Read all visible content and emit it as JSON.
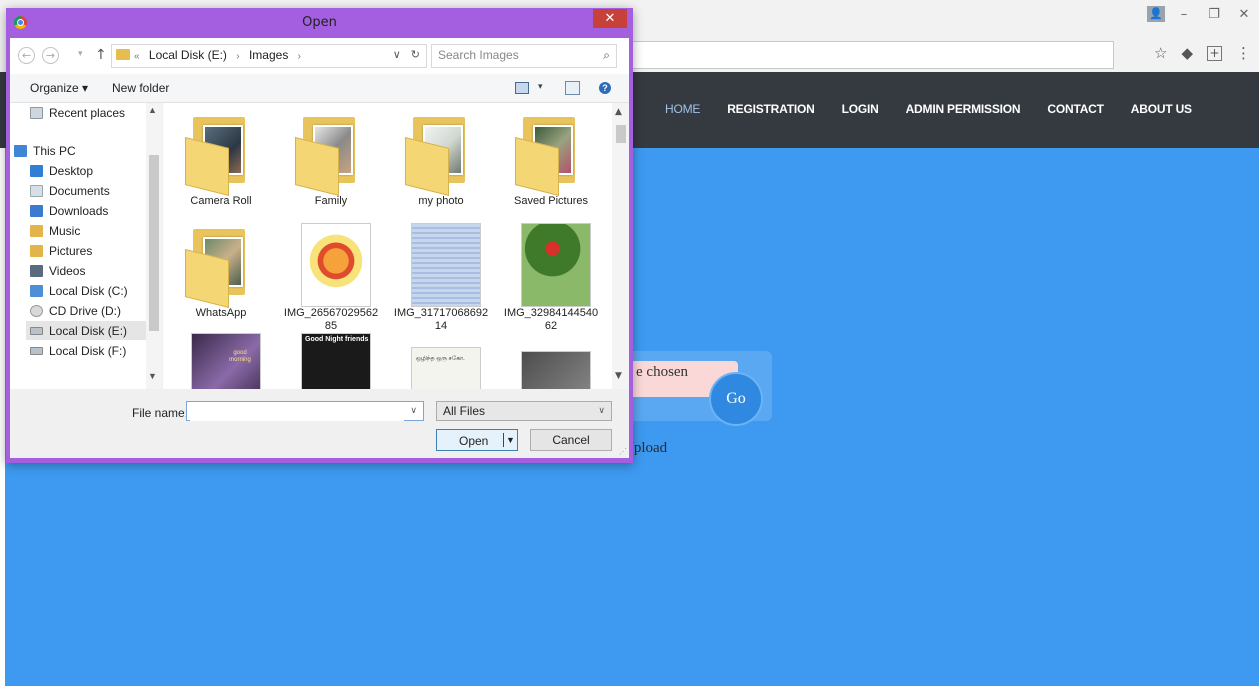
{
  "browser": {
    "window_controls": {
      "user": "👤",
      "minimize": "–",
      "restore": "❐",
      "close": "✕"
    },
    "address_icons": {
      "star": "☆",
      "extension": "◆",
      "plus": "+",
      "menu": "⋮"
    }
  },
  "site": {
    "nav": [
      {
        "label": "HOME"
      },
      {
        "label": "REGISTRATION"
      },
      {
        "label": "LOGIN"
      },
      {
        "label": "ADMIN PERMISSION"
      },
      {
        "label": "CONTACT"
      },
      {
        "label": "ABOUT US"
      }
    ],
    "file_chosen_text": "e chosen",
    "go_label": "Go",
    "upload_text": "Jpload"
  },
  "dialog": {
    "title": "Open",
    "close": "✕",
    "path": [
      "«",
      "Local Disk (E:)",
      "›",
      "Images",
      "›"
    ],
    "search_placeholder": "Search Images",
    "toolbar": {
      "organize": "Organize ▾",
      "new_folder": "New folder",
      "view_dd": "▾",
      "help": "?"
    },
    "nav_items": [
      {
        "label": "Recent places",
        "icon": "recent-places-icon"
      },
      {
        "label": "This PC",
        "icon": "computer-icon"
      },
      {
        "label": "Desktop",
        "icon": "desktop-icon"
      },
      {
        "label": "Documents",
        "icon": "documents-icon"
      },
      {
        "label": "Downloads",
        "icon": "downloads-icon"
      },
      {
        "label": "Music",
        "icon": "music-icon"
      },
      {
        "label": "Pictures",
        "icon": "pictures-icon"
      },
      {
        "label": "Videos",
        "icon": "videos-icon"
      },
      {
        "label": "Local Disk (C:)",
        "icon": "local-disk-icon"
      },
      {
        "label": "CD Drive (D:)",
        "icon": "cd-drive-icon"
      },
      {
        "label": "Local Disk (E:)",
        "icon": "local-disk-icon"
      },
      {
        "label": "Local Disk (F:)",
        "icon": "local-disk-icon"
      }
    ],
    "files": [
      {
        "label": "Camera Roll",
        "type": "folder"
      },
      {
        "label": "Family",
        "type": "folder"
      },
      {
        "label": "my photo",
        "type": "folder"
      },
      {
        "label": "Saved Pictures",
        "type": "folder"
      },
      {
        "label": "WhatsApp",
        "type": "folder"
      },
      {
        "label": "IMG_2656702956285",
        "type": "image"
      },
      {
        "label": "IMG_3171706869214",
        "type": "image"
      },
      {
        "label": "IMG_3298414454062",
        "type": "image"
      },
      {
        "label": "",
        "type": "image"
      },
      {
        "label": "",
        "type": "image"
      },
      {
        "label": "",
        "type": "image"
      },
      {
        "label": "",
        "type": "image"
      }
    ],
    "thumb_texts": {
      "good_night": "Good Night friends",
      "tamil_doc": "ஒழிந்த ஒரு சகோ.",
      "good_morning": "good morning"
    },
    "file_name_label": "File name:",
    "file_name_value": "",
    "filter": "All Files",
    "open_label": "Open",
    "cancel_label": "Cancel"
  }
}
